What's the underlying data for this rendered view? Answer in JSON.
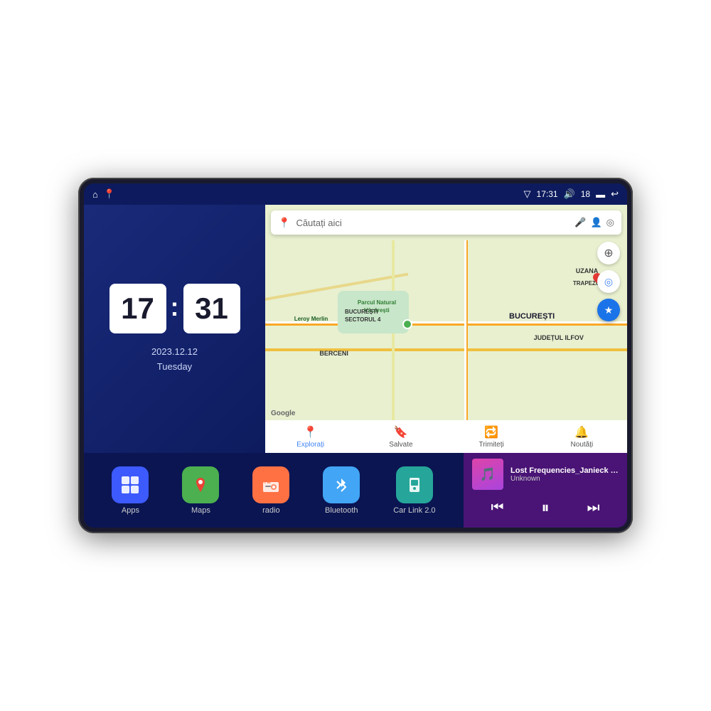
{
  "device": {
    "screen": {
      "statusBar": {
        "leftIcons": [
          "home",
          "maps"
        ],
        "time": "17:31",
        "volume": "18",
        "battery": "rectangle",
        "back": "back-arrow"
      }
    }
  },
  "clock": {
    "hours": "17",
    "minutes": "31",
    "date": "2023.12.12",
    "day": "Tuesday"
  },
  "map": {
    "searchPlaceholder": "Căutați aici",
    "labels": {
      "uzana": "UZANA",
      "trapezului": "TRAPEZULUI",
      "berceni": "BERCENI",
      "bucuresti": "BUCUREȘTI",
      "ilfov": "JUDEȚUL ILFOV",
      "sector4": "BUCUREȘTI\nSECTORUL 4",
      "park": "Parcul Natural\nVăcărești",
      "leroyMerlin": "Leroy Merlin"
    },
    "bottomNav": [
      {
        "label": "Explorați",
        "icon": "📍",
        "active": true
      },
      {
        "label": "Salvate",
        "icon": "🔖",
        "active": false
      },
      {
        "label": "Trimiteți",
        "icon": "🔁",
        "active": false
      },
      {
        "label": "Noutăți",
        "icon": "🔔",
        "active": false
      }
    ],
    "googleLogo": "Google"
  },
  "apps": [
    {
      "id": "apps",
      "label": "Apps",
      "icon": "⊞",
      "color": "#3d5afe"
    },
    {
      "id": "maps",
      "label": "Maps",
      "icon": "🗺",
      "color": "#4caf50"
    },
    {
      "id": "radio",
      "label": "radio",
      "icon": "📻",
      "color": "#ff7043"
    },
    {
      "id": "bluetooth",
      "label": "Bluetooth",
      "icon": "⬡",
      "color": "#42a5f5"
    },
    {
      "id": "carlink",
      "label": "Car Link 2.0",
      "icon": "📱",
      "color": "#26a69a"
    }
  ],
  "music": {
    "title": "Lost Frequencies_Janieck Devy-...",
    "artist": "Unknown",
    "controls": {
      "prev": "⏮",
      "play": "⏸",
      "next": "⏭"
    }
  }
}
